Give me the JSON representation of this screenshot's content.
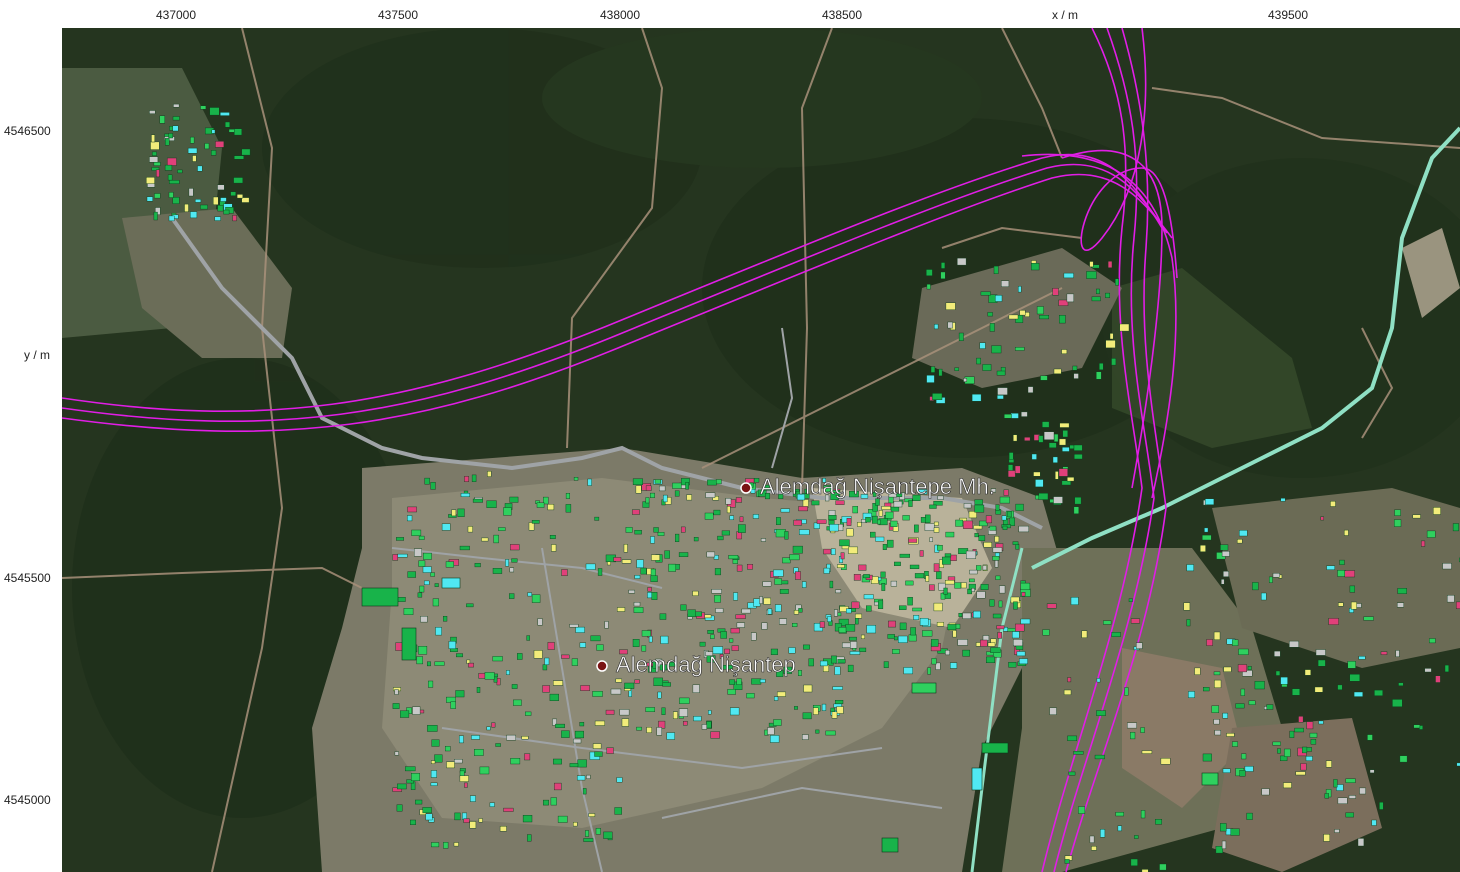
{
  "axes": {
    "x_label": "x / m",
    "y_label": "y / m",
    "x_ticks": [
      "437000",
      "437500",
      "438000",
      "438500",
      "439500"
    ],
    "y_ticks": [
      "4546500",
      "4545500",
      "4545000"
    ]
  },
  "place_labels": [
    {
      "name": "Alemdağ Nişantepe Mh.",
      "icon": "place-pin-icon"
    },
    {
      "name": "Alemdağ Nişantep",
      "icon": "place-pin-icon"
    }
  ],
  "layers": {
    "imagery": "satellite",
    "highway_corridor_color": "#e11ee6",
    "main_road_color": "#8fe0c4",
    "building_colors": [
      "#18b34a",
      "#2fd05e",
      "#50e8f2",
      "#f2ec7a",
      "#c8c8c8",
      "#e0407a"
    ]
  }
}
